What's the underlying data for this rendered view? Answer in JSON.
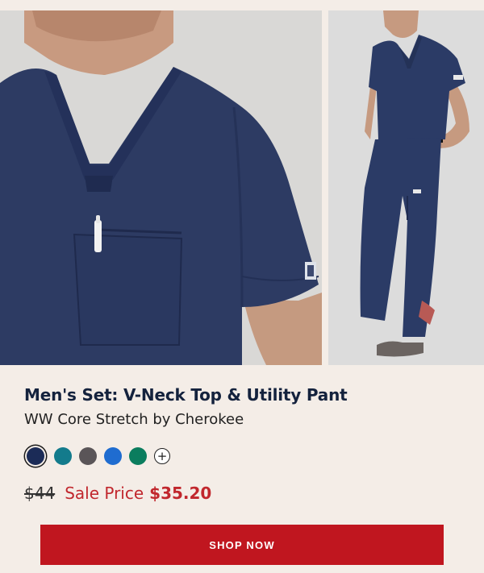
{
  "product": {
    "title": "Men's Set: V-Neck Top & Utility Pant",
    "subtitle": "WW Core Stretch by Cherokee",
    "images": [
      {
        "name": "close-up of v-neck scrub top"
      },
      {
        "name": "full-length scrub set"
      }
    ],
    "swatches": [
      {
        "color": "#1b2b57",
        "selected": true
      },
      {
        "color": "#137b8c",
        "selected": false
      },
      {
        "color": "#5a5558",
        "selected": false
      },
      {
        "color": "#1f6cd0",
        "selected": false
      },
      {
        "color": "#0b7d5e",
        "selected": false
      }
    ],
    "more_colors_symbol": "+",
    "price": {
      "original": "$44",
      "sale_label": "Sale Price",
      "sale": "$35.20"
    },
    "cta": "SHOP NOW"
  },
  "colors": {
    "background": "#f4ede7",
    "accent": "#c0161f",
    "title": "#14223d",
    "scrub_navy": "#2a3a63"
  }
}
